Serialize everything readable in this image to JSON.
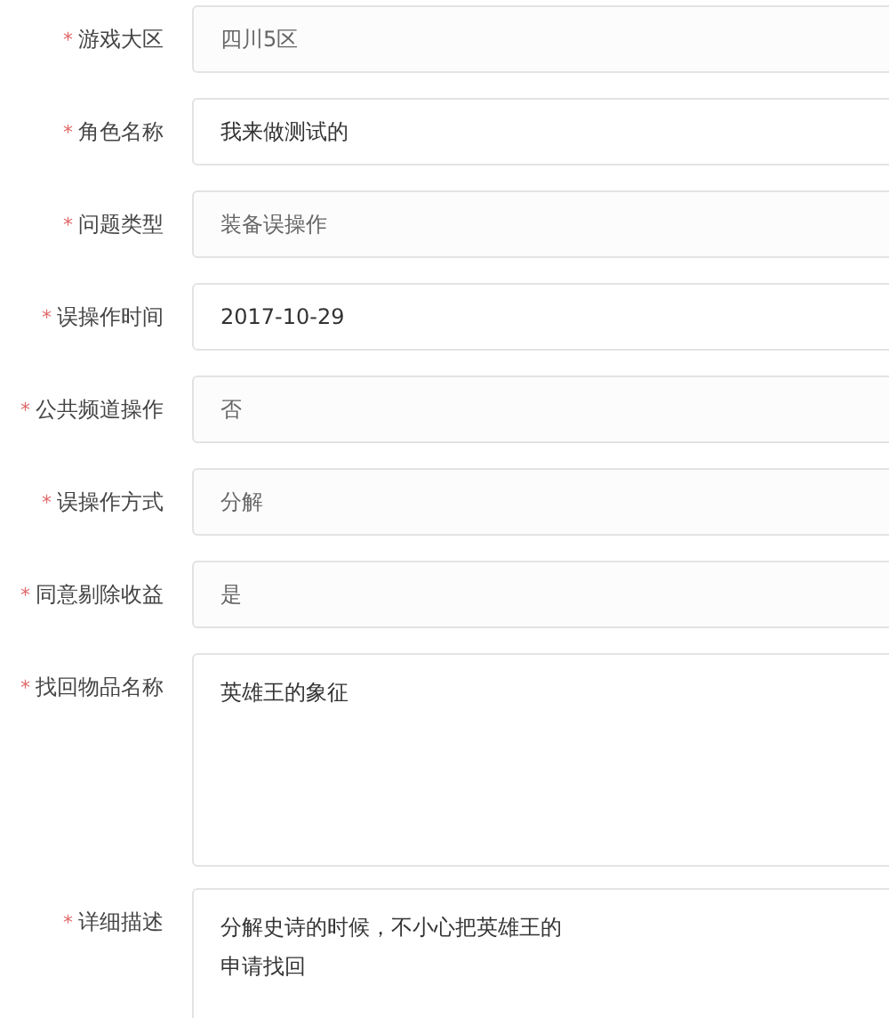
{
  "form": {
    "fields": [
      {
        "kind": "input",
        "required_mark": "*",
        "label": "游戏大区",
        "value": "四川5区",
        "disabled": true
      },
      {
        "kind": "input",
        "required_mark": "*",
        "label": "角色名称",
        "value": "我来做测试的",
        "disabled": false
      },
      {
        "kind": "input",
        "required_mark": "*",
        "label": "问题类型",
        "value": "装备误操作",
        "disabled": true
      },
      {
        "kind": "input",
        "required_mark": "*",
        "label": "误操作时间",
        "value": "2017-10-29",
        "disabled": false
      },
      {
        "kind": "input",
        "required_mark": "*",
        "label": "公共频道操作",
        "value": "否",
        "disabled": true
      },
      {
        "kind": "input",
        "required_mark": "*",
        "label": "误操作方式",
        "value": "分解",
        "disabled": true
      },
      {
        "kind": "input",
        "required_mark": "*",
        "label": "同意剔除收益",
        "value": "是",
        "disabled": true
      },
      {
        "kind": "textarea",
        "required_mark": "*",
        "label": "找回物品名称",
        "lines": [
          "英雄王的象征"
        ],
        "disabled": false
      },
      {
        "kind": "textarea",
        "required_mark": "*",
        "label": "详细描述",
        "lines": [
          "分解史诗的时候，不小心把英雄王的",
          "申请找回"
        ],
        "disabled": false
      }
    ]
  }
}
